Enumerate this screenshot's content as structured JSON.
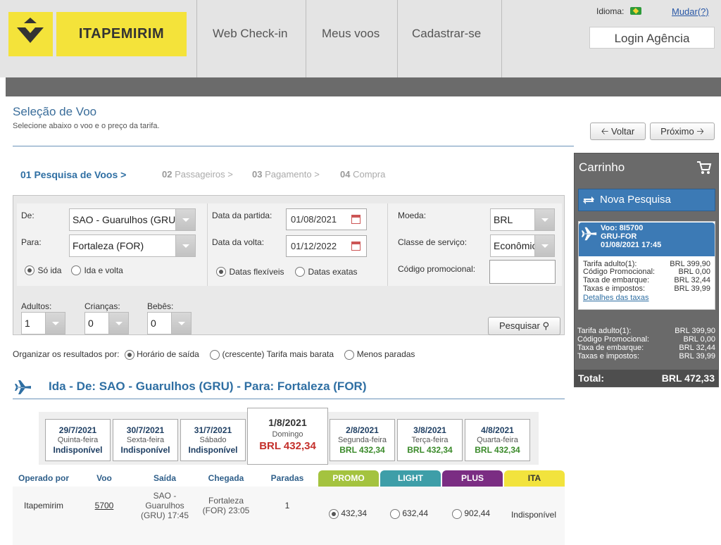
{
  "brand": {
    "name": "ITAPEMIRIM",
    "yellow": "#f4e33a"
  },
  "header": {
    "nav": [
      "Web Check-in",
      "Meus voos",
      "Cadastrar-se"
    ],
    "language_label": "Idioma:",
    "change_label": "Mudar(?)",
    "login_label": "Login Agência"
  },
  "page": {
    "title": "Seleção de Voo",
    "subtitle": "Selecione abaixo o voo e o preço da tarifa.",
    "back_label": "Voltar",
    "next_label": "Próximo"
  },
  "steps": [
    {
      "num": "01",
      "label": "Pesquisa de Voos >"
    },
    {
      "num": "02",
      "label": "Passageiros >"
    },
    {
      "num": "03",
      "label": "Pagamento >"
    },
    {
      "num": "04",
      "label": "Compra"
    }
  ],
  "form": {
    "from_label": "De:",
    "from_value": "SAO - Guarulhos (GRU)",
    "to_label": "Para:",
    "to_value": "Fortaleza (FOR)",
    "one_way_label": "Só ida",
    "round_trip_label": "Ida e volta",
    "depart_label": "Data da partida:",
    "depart_value": "01/08/2021",
    "return_label": "Data da volta:",
    "return_value": "01/12/2022",
    "flex_label": "Datas flexíveis",
    "exact_label": "Datas exatas",
    "currency_label": "Moeda:",
    "currency_value": "BRL",
    "class_label": "Classe de serviço:",
    "class_value": "Econômica",
    "promo_label": "Código promocional:",
    "adults_label": "Adultos:",
    "adults_value": "1",
    "children_label": "Crianças:",
    "children_value": "0",
    "infants_label": "Bebês:",
    "infants_value": "0",
    "search_label": "Pesquisar"
  },
  "sort": {
    "label": "Organizar os resultados por:",
    "options": [
      "Horário de saída",
      "(crescente) Tarifa mais barata",
      "Menos paradas"
    ]
  },
  "flight_section": {
    "title": "Ida - De: SAO - Guarulhos (GRU) - Para: Fortaleza (FOR)"
  },
  "date_tabs": [
    {
      "date": "29/7/2021",
      "weekday": "Quinta-feira",
      "price": "Indisponível"
    },
    {
      "date": "30/7/2021",
      "weekday": "Sexta-feira",
      "price": "Indisponível"
    },
    {
      "date": "31/7/2021",
      "weekday": "Sábado",
      "price": "Indisponível"
    },
    {
      "date": "1/8/2021",
      "weekday": "Domingo",
      "price": "BRL 432,34"
    },
    {
      "date": "2/8/2021",
      "weekday": "Segunda-feira",
      "price": "BRL 432,34"
    },
    {
      "date": "3/8/2021",
      "weekday": "Terça-feira",
      "price": "BRL 432,34"
    },
    {
      "date": "4/8/2021",
      "weekday": "Quarta-feira",
      "price": "BRL 432,34"
    }
  ],
  "table": {
    "headers": [
      "Operado por",
      "Voo",
      "Saída",
      "Chegada",
      "Paradas"
    ],
    "fares": [
      {
        "name": "PROMO",
        "color": "#a4c33f"
      },
      {
        "name": "LIGHT",
        "color": "#3e9ea8"
      },
      {
        "name": "PLUS",
        "color": "#7b2d83"
      },
      {
        "name": "ITA",
        "color": "#f2e33d"
      }
    ],
    "row": {
      "operator": "Itapemirim",
      "flight": "5700",
      "dep_l1": "SAO -",
      "dep_l2": "Guarulhos",
      "dep_l3": "(GRU) 17:45",
      "arr_l1": "Fortaleza",
      "arr_l2": "(FOR) 23:05",
      "stops": "1",
      "promo": "432,34",
      "light": "632,44",
      "plus": "902,44",
      "ita": "Indisponível"
    }
  },
  "cart": {
    "title": "Carrinho",
    "new_search": "Nova Pesquisa",
    "flight_l1": "Voo: 8I5700",
    "flight_l2": "GRU-FOR",
    "flight_l3": "01/08/2021 17:45",
    "lines": [
      {
        "label": "Tarifa adulto(1):",
        "value": "BRL 399,90"
      },
      {
        "label": "Código Promocional:",
        "value": "BRL 0,00"
      },
      {
        "label": "Taxa de embarque:",
        "value": "BRL 32,44"
      },
      {
        "label": "Taxas e impostos:",
        "value": "BRL 39,99"
      }
    ],
    "tax_link": "Detalhes das taxas",
    "total_label": "Total:",
    "total_value": "BRL 472,33"
  }
}
